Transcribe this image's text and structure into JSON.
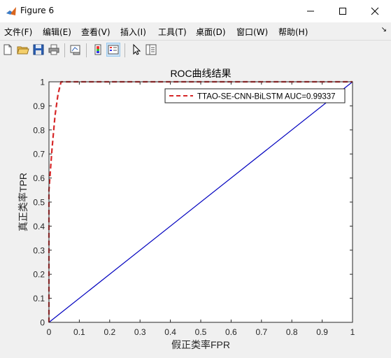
{
  "window": {
    "title": "Figure 6",
    "icon": "matlab-figure-icon",
    "controls": [
      "minimize-icon",
      "maximize-icon",
      "close-icon"
    ]
  },
  "menu": [
    {
      "label": "文件(F)"
    },
    {
      "label": "编辑(E)"
    },
    {
      "label": "查看(V)"
    },
    {
      "label": "插入(I)"
    },
    {
      "label": "工具(T)"
    },
    {
      "label": "桌面(D)"
    },
    {
      "label": "窗口(W)"
    },
    {
      "label": "帮助(H)"
    }
  ],
  "toolbar": [
    "new-figure-icon",
    "open-file-icon",
    "save-icon",
    "print-icon",
    "link-plot-icon",
    "insert-colorbar-icon",
    "insert-legend-icon",
    "edit-plot-icon",
    "property-inspector-icon"
  ],
  "colors": {
    "roc_curve": "#d62728",
    "diagonal": "#0000bf"
  },
  "chart_data": {
    "type": "line",
    "title": "ROC曲线结果",
    "xlabel": "假正类率FPR",
    "ylabel": "真正类率TPR",
    "xlim": [
      0,
      1
    ],
    "ylim": [
      0,
      1
    ],
    "xticks": [
      "0",
      "0.1",
      "0.2",
      "0.3",
      "0.4",
      "0.5",
      "0.6",
      "0.7",
      "0.8",
      "0.9",
      "1"
    ],
    "yticks": [
      "0",
      "0.1",
      "0.2",
      "0.3",
      "0.4",
      "0.5",
      "0.6",
      "0.7",
      "0.8",
      "0.9",
      "1"
    ],
    "grid": false,
    "legend_position": "top-right",
    "series": [
      {
        "name": "TTAO-SE-CNN-BiLSTM AUC=0.99337",
        "style": "dashed",
        "color": "#d62728",
        "x": [
          0,
          0,
          0.01,
          0.02,
          0.03,
          0.04,
          1
        ],
        "y": [
          0,
          0.55,
          0.72,
          0.86,
          0.95,
          1,
          1
        ]
      },
      {
        "style": "solid",
        "color": "#0000bf",
        "x": [
          0,
          1
        ],
        "y": [
          0,
          1
        ]
      }
    ]
  }
}
